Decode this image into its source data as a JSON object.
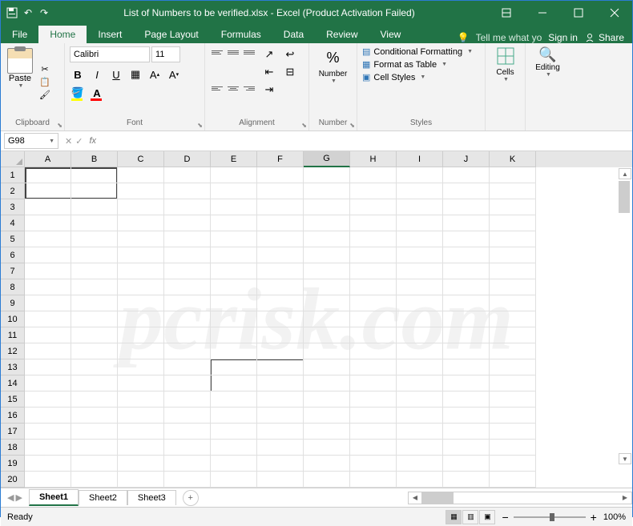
{
  "title_text": "List of Numbers to be verified.xlsx - Excel (Product Activation Failed)",
  "tabs": {
    "file": "File",
    "home": "Home",
    "insert": "Insert",
    "pagelayout": "Page Layout",
    "formulas": "Formulas",
    "data": "Data",
    "review": "Review",
    "view": "View"
  },
  "tellme": "Tell me what yo",
  "signin": "Sign in",
  "share": "Share",
  "ribbon": {
    "clipboard": {
      "label": "Clipboard",
      "paste": "Paste"
    },
    "font": {
      "label": "Font",
      "name": "Calibri",
      "size": "11",
      "bold": "B",
      "italic": "I",
      "underline": "U"
    },
    "alignment": {
      "label": "Alignment"
    },
    "number": {
      "label": "Number",
      "btn": "Number"
    },
    "styles": {
      "label": "Styles",
      "cond": "Conditional Formatting",
      "table": "Format as Table",
      "cell": "Cell Styles"
    },
    "cells": {
      "label": "Cells"
    },
    "editing": {
      "label": "Editing"
    }
  },
  "namebox": "G98",
  "fx": "fx",
  "columns": [
    "A",
    "B",
    "C",
    "D",
    "E",
    "F",
    "G",
    "H",
    "I",
    "J",
    "K"
  ],
  "rows": [
    "1",
    "2",
    "3",
    "4",
    "5",
    "6",
    "7",
    "8",
    "9",
    "10",
    "11",
    "12",
    "13",
    "14",
    "15",
    "16",
    "17",
    "18",
    "19",
    "20"
  ],
  "selected_col": "G",
  "sheets": {
    "s1": "Sheet1",
    "s2": "Sheet2",
    "s3": "Sheet3"
  },
  "status": "Ready",
  "zoom": "100%",
  "watermark": "pcrisk.com"
}
